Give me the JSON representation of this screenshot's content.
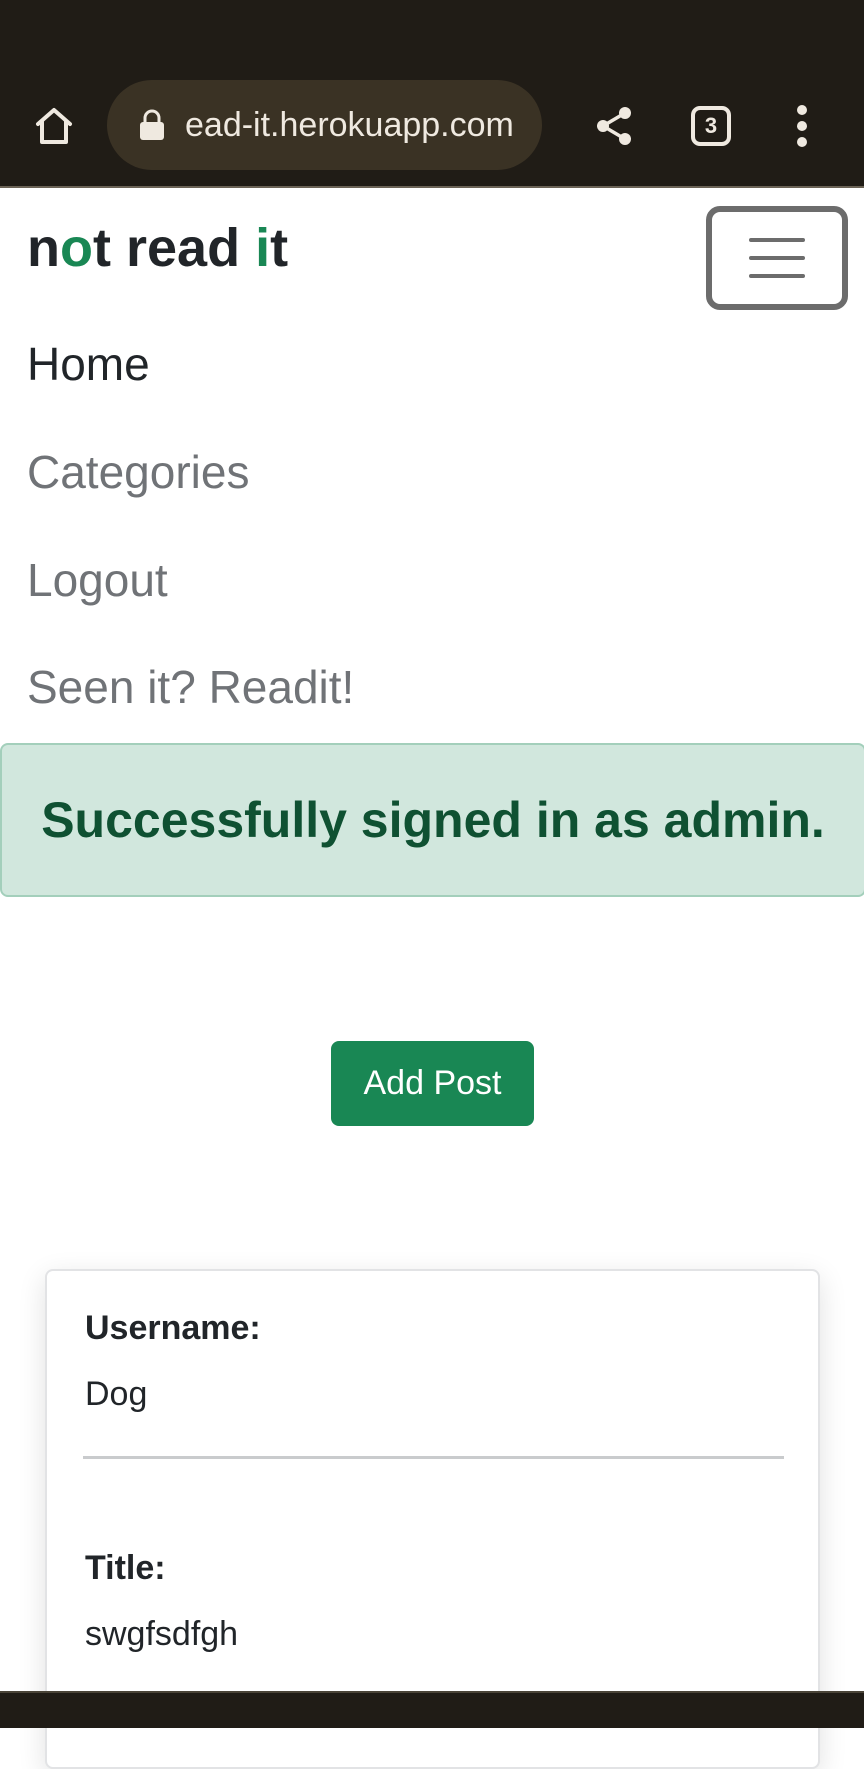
{
  "browser": {
    "url": "ead-it.herokuapp.com",
    "tab_count": "3",
    "icons": {
      "home": "home-icon",
      "lock": "lock-icon",
      "share": "share-icon",
      "tabs": "tabs-icon",
      "menu": "more-vert-icon"
    }
  },
  "navbar": {
    "brand": {
      "part1": "n",
      "part2": "o",
      "part3": "t read ",
      "part4": "i",
      "part5": "t"
    },
    "toggler_icon": "hamburger-icon",
    "links": [
      {
        "label": "Home"
      },
      {
        "label": "Categories"
      },
      {
        "label": "Logout"
      },
      {
        "label": "Seen it? Readit!"
      }
    ]
  },
  "alert": {
    "message": "Successfully signed in as admin."
  },
  "actions": {
    "add_post_label": "Add Post"
  },
  "post": {
    "username_label": "Username:",
    "username": "Dog",
    "title_label": "Title:",
    "title": "swgfsdfgh"
  },
  "colors": {
    "browser_bar": "#201c16",
    "brand_accent": "#198754",
    "alert_bg": "#d1e7dd",
    "alert_text": "#0f5132",
    "button_bg": "#198754"
  }
}
